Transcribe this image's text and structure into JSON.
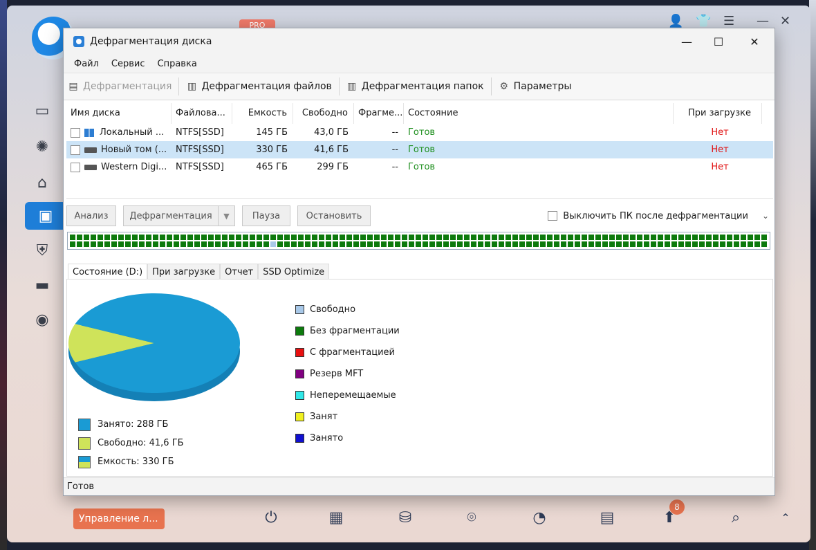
{
  "host": {
    "pro_badge": "PRO",
    "manage_button": "Управление л...",
    "notify_count": "8"
  },
  "window": {
    "title": "Дефрагментация диска"
  },
  "menu": [
    "Файл",
    "Сервис",
    "Справка"
  ],
  "toolbar": {
    "defrag": "Дефрагментация",
    "defrag_files": "Дефрагментация файлов",
    "defrag_folders": "Дефрагментация папок",
    "settings": "Параметры"
  },
  "table": {
    "headers": [
      "Имя диска",
      "Файлова...",
      "Емкость",
      "Свободно",
      "Фрагме...",
      "Состояние",
      "При загрузке"
    ],
    "rows": [
      {
        "name": "Локальный ...",
        "fs": "NTFS[SSD]",
        "capacity": "145 ГБ",
        "free": "43,0 ГБ",
        "frag": "--",
        "state": "Готов",
        "boot": "Нет"
      },
      {
        "name": "Новый том (...",
        "fs": "NTFS[SSD]",
        "capacity": "330 ГБ",
        "free": "41,6 ГБ",
        "frag": "--",
        "state": "Готов",
        "boot": "Нет"
      },
      {
        "name": "Western Digi...",
        "fs": "NTFS[SSD]",
        "capacity": "465 ГБ",
        "free": "299 ГБ",
        "frag": "--",
        "state": "Готов",
        "boot": "Нет"
      }
    ]
  },
  "actions": {
    "analyze": "Анализ",
    "defrag": "Дефрагментация",
    "pause": "Пауза",
    "stop": "Остановить",
    "shutdown_label": "Выключить ПК после дефрагментации"
  },
  "tabs": [
    "Состояние (D:)",
    "При загрузке",
    "Отчет",
    "SSD Optimize"
  ],
  "legend": [
    {
      "label": "Свободно",
      "color": "#a8c8e8"
    },
    {
      "label": "Без фрагментации",
      "color": "#0d7a0d"
    },
    {
      "label": "С фрагментацией",
      "color": "#e81010"
    },
    {
      "label": "Резерв MFT",
      "color": "#800080"
    },
    {
      "label": "Неперемещаемые",
      "color": "#30e8e8"
    },
    {
      "label": "Занят",
      "color": "#f0f020"
    },
    {
      "label": "Занято",
      "color": "#1010d0"
    }
  ],
  "pie_legend": [
    {
      "label": "Занято: 288 ГБ",
      "color": "#1a9bd4"
    },
    {
      "label": "Свободно: 41,6 ГБ",
      "color": "#cfe35a"
    },
    {
      "label": "Емкость: 330 ГБ",
      "color": "#1a9bd4"
    }
  ],
  "chart_data": {
    "type": "pie",
    "categories": [
      "Занято",
      "Свободно"
    ],
    "values": [
      288,
      41.6
    ],
    "unit": "ГБ",
    "colors": [
      "#1a9bd4",
      "#cfe35a"
    ]
  },
  "status": "Готов"
}
